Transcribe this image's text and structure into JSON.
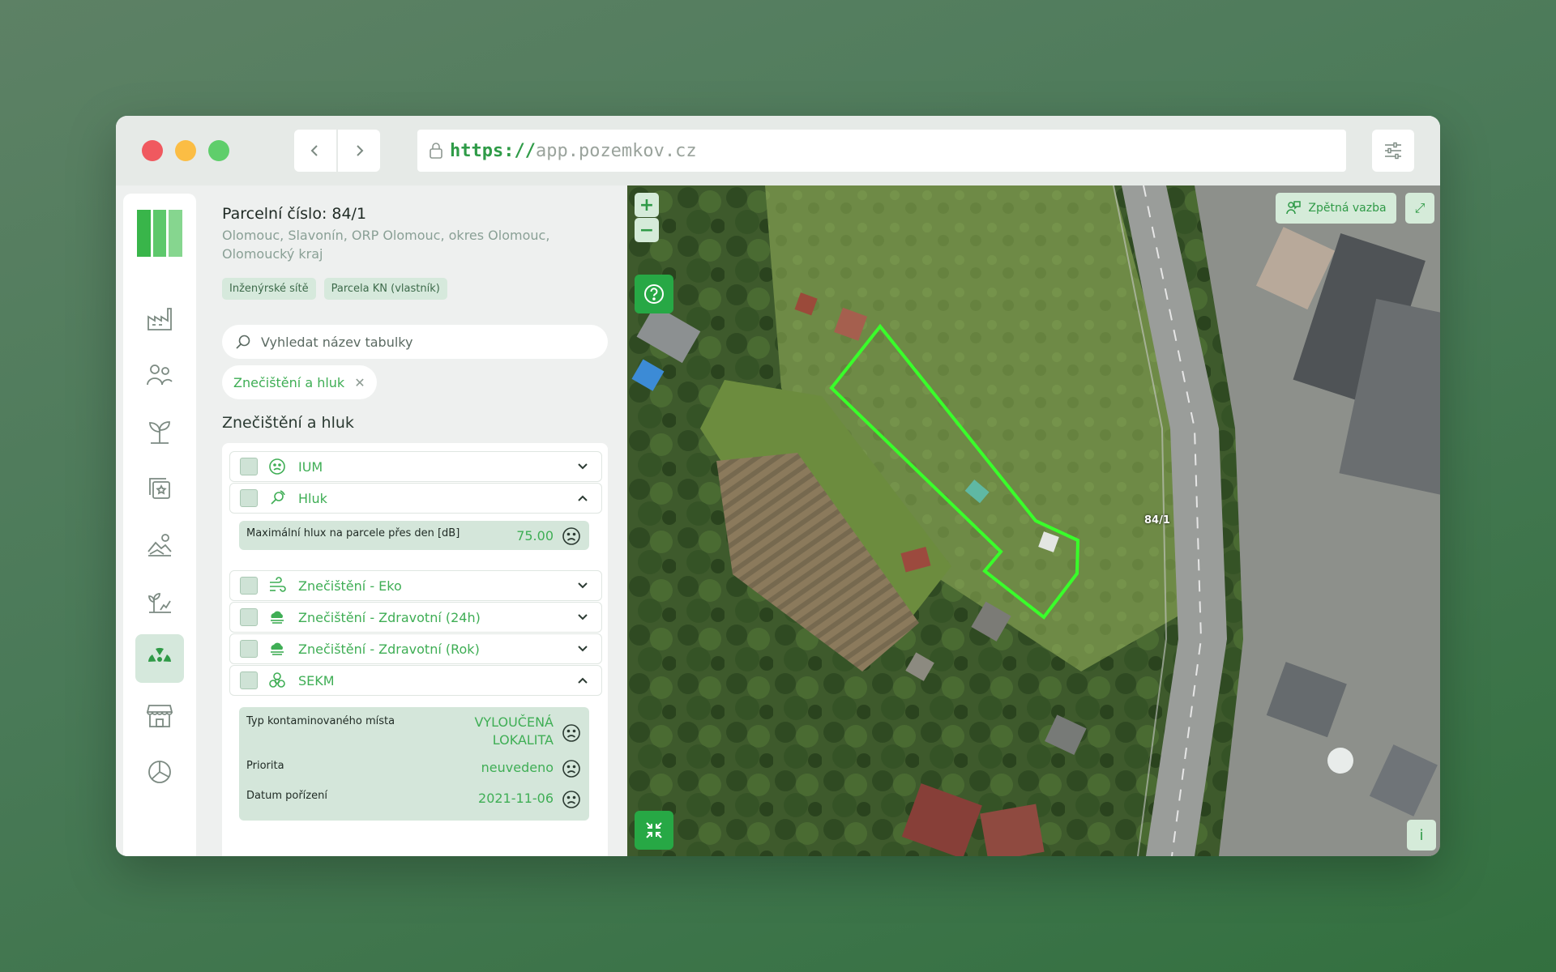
{
  "browser": {
    "url_scheme": "https://",
    "url_host": "app.pozemkov.cz"
  },
  "rail": {
    "icons": [
      "factory-icon",
      "people-icon",
      "sprout-icon",
      "star-square-icon",
      "landscape-icon",
      "growth-chart-icon",
      "radiation-icon",
      "store-icon",
      "pie-chart-icon"
    ],
    "active": "radiation-icon"
  },
  "parcel": {
    "title": "Parcelní číslo: 84/1",
    "location": "Olomouc, Slavonín, ORP Olomouc, okres Olomouc, Olomoucký kraj",
    "tags": [
      "Inženýrské sítě",
      "Parcela KN (vlastník)"
    ]
  },
  "search": {
    "placeholder": "Vyhledat název tabulky"
  },
  "filter_chip": {
    "label": "Znečištění a hluk"
  },
  "section": {
    "title": "Znečištění a hluk",
    "rows": [
      {
        "label": "IUM",
        "expanded": false
      },
      {
        "label": "Hluk",
        "expanded": true
      },
      {
        "label": "Znečištění - Eko",
        "expanded": false
      },
      {
        "label": "Znečištění - Zdravotní (24h)",
        "expanded": false
      },
      {
        "label": "Znečištění - Zdravotní (Rok)",
        "expanded": false
      },
      {
        "label": "SEKM",
        "expanded": true
      }
    ],
    "hluk_detail": {
      "label": "Maximální hlux na parcele přes den [dB]",
      "value": "75.00"
    },
    "sekm_detail": [
      {
        "label": "Typ kontaminovaného místa",
        "value": "VYLOUČENÁ LOKALITA"
      },
      {
        "label": "Priorita",
        "value": "neuvedeno"
      },
      {
        "label": "Datum pořízení",
        "value": "2021-11-06"
      }
    ]
  },
  "map": {
    "zoom_in": "+",
    "zoom_out": "−",
    "feedback_label": "Zpětná vazba",
    "parcel_label": "84/1",
    "info_label": "i",
    "expand_label": "⤢"
  },
  "colors": {
    "accent": "#3fae55",
    "accent_dark": "#27a845",
    "parcel_outline": "#39ff2a"
  }
}
